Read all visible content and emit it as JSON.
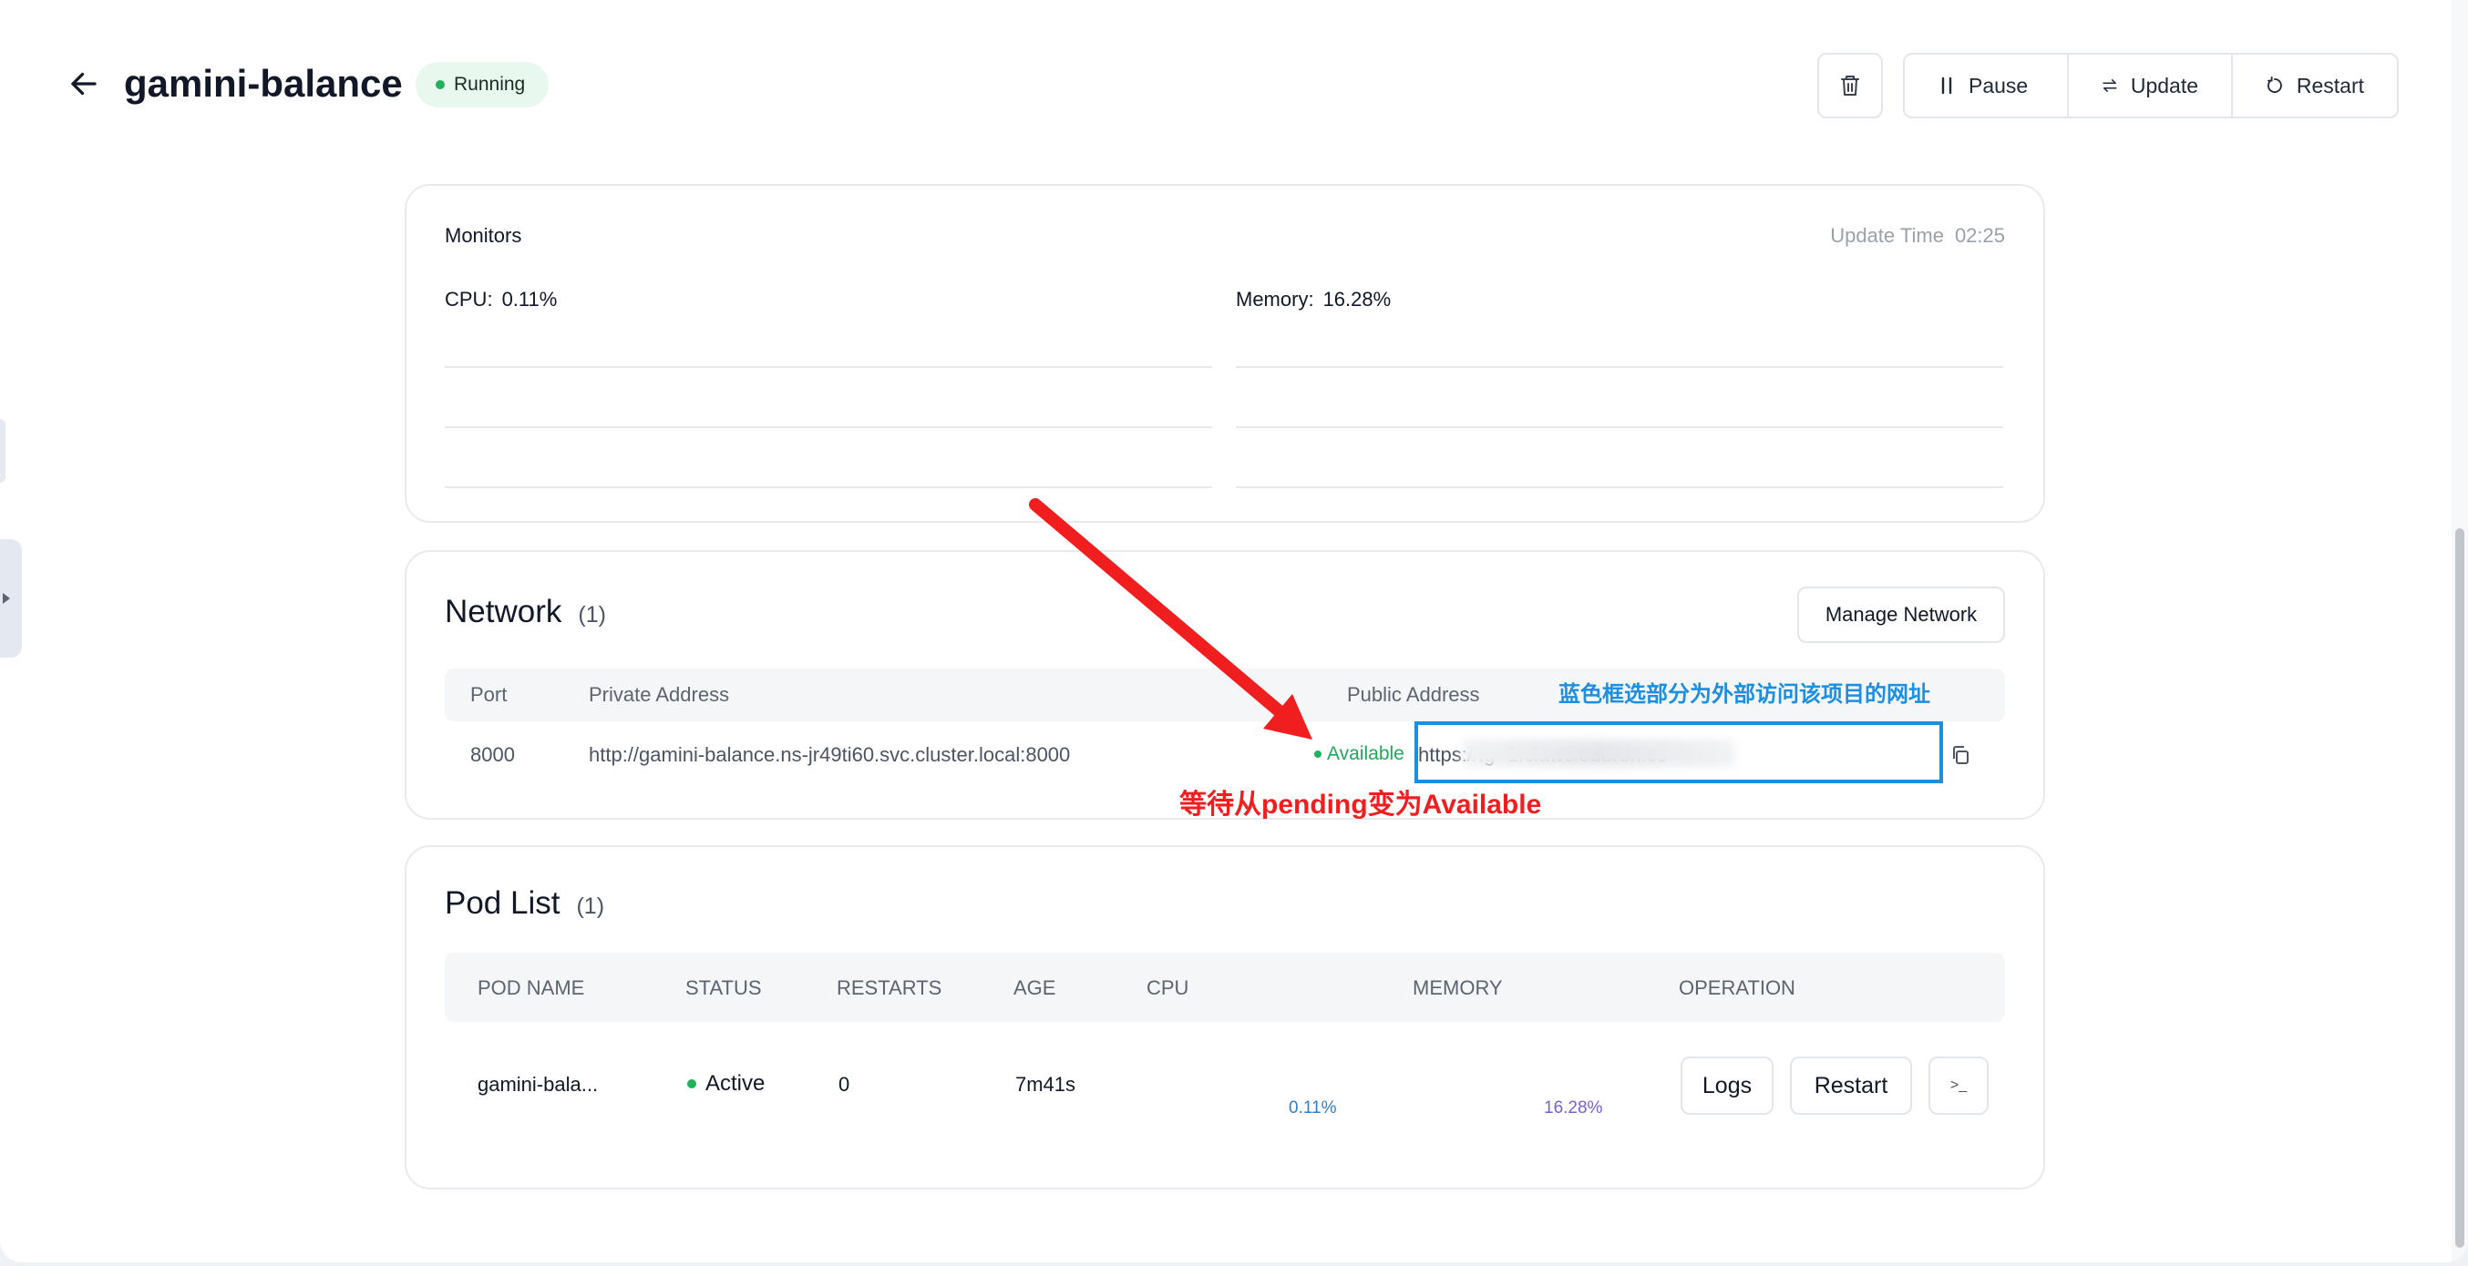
{
  "header": {
    "title": "gamini-balance",
    "status": "Running",
    "pause_label": "Pause",
    "update_label": "Update",
    "restart_label": "Restart"
  },
  "monitors": {
    "title": "Monitors",
    "update_time_label": "Update Time",
    "update_time_value": "02:25",
    "cpu_label": "CPU:",
    "cpu_value": "0.11%",
    "memory_label": "Memory:",
    "memory_value": "16.28%"
  },
  "network": {
    "title": "Network",
    "count": "(1)",
    "manage_label": "Manage Network",
    "columns": [
      "Port",
      "Private Address",
      "Public Address"
    ],
    "row": {
      "port": "8000",
      "private_address": "http://gamini-balance.ns-jr49ti60.svc.cluster.local:8000",
      "status": "Available",
      "public_address": "https://tg                                       -1.clawcloudrun.co"
    }
  },
  "pods": {
    "title": "Pod List",
    "count": "(1)",
    "columns": [
      "POD NAME",
      "STATUS",
      "RESTARTS",
      "AGE",
      "CPU",
      "MEMORY",
      "OPERATION"
    ],
    "row": {
      "name": "gamini-bala...",
      "status": "Active",
      "restarts": "0",
      "age": "7m41s",
      "cpu": "0.11%",
      "memory": "16.28%",
      "logs_label": "Logs",
      "restart_label": "Restart",
      "terminal_label": ">_"
    }
  },
  "annotations": {
    "blue_note": "蓝色框选部分为外部访问该项目的网址",
    "red_note": "等待从pending变为Available"
  },
  "colors": {
    "running_green": "#20b15a",
    "annotation_blue": "#1d8fe0",
    "annotation_red": "#f01e1e",
    "cpu_blue": "#2f7fcc",
    "memory_purple": "#7b5fd0"
  },
  "icons": [
    "arrow-left-icon",
    "trash-icon",
    "pause-icon",
    "swap-icon",
    "restart-icon",
    "copy-icon",
    "terminal-icon",
    "chevron-right-icon"
  ]
}
